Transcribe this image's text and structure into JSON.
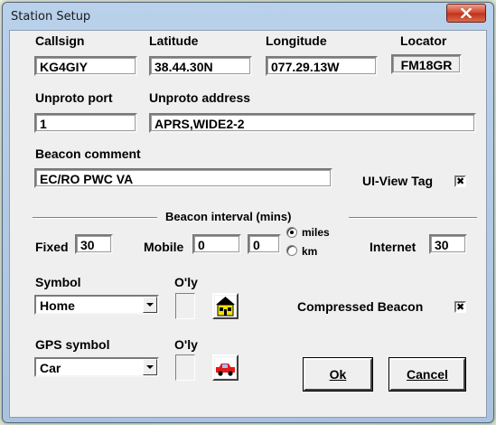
{
  "window": {
    "title": "Station Setup"
  },
  "station": {
    "callsign_label": "Callsign",
    "callsign_value": "KG4GIY",
    "latitude_label": "Latitude",
    "latitude_value": "38.44.30N",
    "longitude_label": "Longitude",
    "longitude_value": "077.29.13W",
    "locator_label": "Locator",
    "locator_value": "FM18GR",
    "unproto_port_label": "Unproto port",
    "unproto_port_value": "1",
    "unproto_address_label": "Unproto address",
    "unproto_address_value": "APRS,WIDE2-2",
    "beacon_comment_label": "Beacon comment",
    "beacon_comment_value": "EC/RO PWC VA",
    "uiview_tag_label": "UI-View Tag",
    "uiview_tag_checked": true
  },
  "interval": {
    "title": "Beacon interval (mins)",
    "fixed_label": "Fixed",
    "fixed_value": "30",
    "mobile_label": "Mobile",
    "mobile_value1": "0",
    "mobile_value2": "0",
    "miles_label": "miles",
    "km_label": "km",
    "selected_unit": "miles",
    "internet_label": "Internet",
    "internet_value": "30"
  },
  "symbols": {
    "symbol_label": "Symbol",
    "symbol_value": "Home",
    "overlay_label": "O'ly",
    "symbol_icon": "house-icon",
    "gps_symbol_label": "GPS symbol",
    "gps_symbol_value": "Car",
    "gps_overlay_label": "O'ly",
    "gps_symbol_icon": "car-icon",
    "compressed_label": "Compressed Beacon",
    "compressed_checked": true
  },
  "buttons": {
    "ok_label": "Ok",
    "cancel_label": "Cancel"
  }
}
